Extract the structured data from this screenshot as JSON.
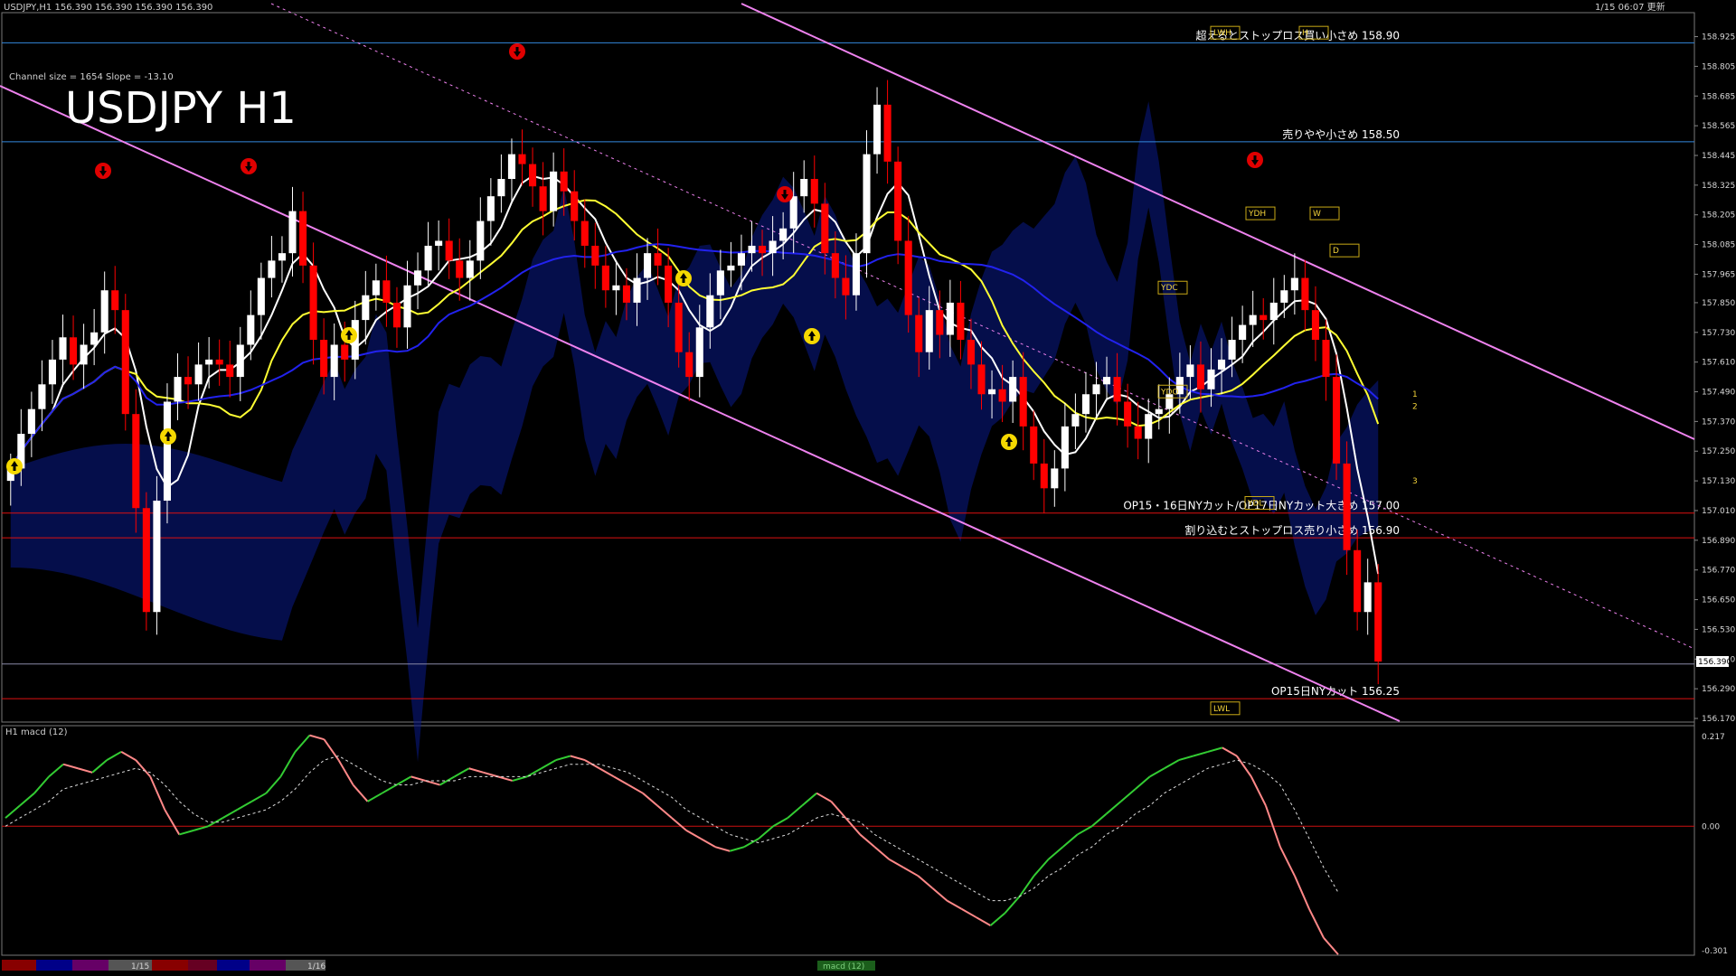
{
  "header": {
    "symbol_line": "USDJPY,H1   156.390 156.390 156.390 156.390",
    "channel_info": "Channel size = 1654 Slope = -13.10",
    "big_title": "USDJPY H1",
    "clock": "1/15 06:07 更新"
  },
  "subpanel": {
    "title": "H1  macd (12)"
  },
  "bottom_bar": {
    "dates": [
      "1/15",
      "1/16"
    ],
    "button": "macd (12)"
  },
  "colors": {
    "background": "#000000",
    "bull_candle": "#ffffff",
    "bear_candle": "#ff0000",
    "ma_fast": "#ffffff",
    "ma_mid": "#ffff33",
    "ma_slow": "#2222ee",
    "channel": "#ee82ee",
    "macd_up": "#33cc33",
    "macd_down": "#ff8888",
    "level_blue": "#3388dd",
    "level_red": "#dd1111",
    "current_price": "#8a8aa8"
  },
  "markers": {
    "up_arrow_icons": 6,
    "down_arrow_icons": 5
  },
  "chart_data": [
    {
      "type": "candlestick",
      "title": "USDJPY H1",
      "ylim": [
        156.17,
        159.0
      ],
      "y_ticks": [
        "158.925",
        "158.805",
        "158.685",
        "158.565",
        "158.445",
        "158.325",
        "158.205",
        "158.085",
        "157.965",
        "157.850",
        "157.730",
        "157.610",
        "157.490",
        "157.370",
        "157.250",
        "157.130",
        "157.010",
        "156.890",
        "156.770",
        "156.650",
        "156.530",
        "156.410",
        "156.290",
        "156.170"
      ],
      "current_price": "156.390",
      "levels": [
        {
          "price": 158.9,
          "label": "超えるとストップロス買い小さめ 158.90",
          "color": "#3388dd"
        },
        {
          "price": 158.5,
          "label": "売りやや小さめ 158.50",
          "color": "#3388dd"
        },
        {
          "price": 157.0,
          "label": "OP15・16日NYカット/OP17日NYカット大きめ 157.00",
          "color": "#dd1111"
        },
        {
          "price": 156.9,
          "label": "割り込むとストップロス売り小さめ 156.90",
          "color": "#dd1111"
        },
        {
          "price": 156.25,
          "label": "OP15日NYカット 156.25",
          "color": "#dd1111"
        }
      ],
      "tags": [
        "LWH",
        "H",
        "YDH",
        "W",
        "D",
        "YDC",
        "YDO",
        "YDL",
        "LWL",
        "1",
        "2",
        "3"
      ],
      "close": [
        157.18,
        157.32,
        157.42,
        157.52,
        157.62,
        157.71,
        157.6,
        157.68,
        157.73,
        157.9,
        157.82,
        157.4,
        157.02,
        156.6,
        157.05,
        157.45,
        157.55,
        157.52,
        157.6,
        157.62,
        157.6,
        157.55,
        157.68,
        157.8,
        157.95,
        158.02,
        158.05,
        158.22,
        158.0,
        157.7,
        157.55,
        157.68,
        157.62,
        157.78,
        157.88,
        157.94,
        157.85,
        157.75,
        157.92,
        157.98,
        158.08,
        158.1,
        158.02,
        157.95,
        158.02,
        158.18,
        158.28,
        158.35,
        158.45,
        158.41,
        158.32,
        158.22,
        158.38,
        158.3,
        158.18,
        158.08,
        158.0,
        157.9,
        157.92,
        157.85,
        157.95,
        158.05,
        158.0,
        157.85,
        157.65,
        157.55,
        157.75,
        157.88,
        157.98,
        158.0,
        158.05,
        158.08,
        158.05,
        158.1,
        158.15,
        158.28,
        158.35,
        158.25,
        158.05,
        157.95,
        157.88,
        158.05,
        158.45,
        158.65,
        158.42,
        158.1,
        157.8,
        157.65,
        157.82,
        157.72,
        157.85,
        157.7,
        157.6,
        157.48,
        157.5,
        157.45,
        157.55,
        157.35,
        157.2,
        157.1,
        157.18,
        157.35,
        157.4,
        157.48,
        157.52,
        157.55,
        157.45,
        157.35,
        157.3,
        157.4,
        157.42,
        157.48,
        157.55,
        157.6,
        157.5,
        157.58,
        157.62,
        157.7,
        157.76,
        157.8,
        157.78,
        157.85,
        157.9,
        157.95,
        157.82,
        157.7,
        157.55,
        157.2,
        156.85,
        156.6,
        156.72,
        156.4
      ]
    },
    {
      "type": "line",
      "title": "H1  macd (12)",
      "ylim": [
        -0.301,
        0.217
      ],
      "y_ticks": [
        "0.217",
        "0.00",
        "-0.301"
      ],
      "series": [
        {
          "values": [
            0.02,
            0.05,
            0.08,
            0.12,
            0.15,
            0.14,
            0.13,
            0.16,
            0.18,
            0.16,
            0.12,
            0.04,
            -0.02,
            -0.01,
            0.0,
            0.02,
            0.04,
            0.06,
            0.08,
            0.12,
            0.18,
            0.22,
            0.21,
            0.16,
            0.1,
            0.06,
            0.08,
            0.1,
            0.12,
            0.11,
            0.1,
            0.12,
            0.14,
            0.13,
            0.12,
            0.11,
            0.12,
            0.14,
            0.16,
            0.17,
            0.16,
            0.14,
            0.12,
            0.1,
            0.08,
            0.05,
            0.02,
            -0.01,
            -0.03,
            -0.05,
            -0.06,
            -0.05,
            -0.03,
            0.0,
            0.02,
            0.05,
            0.08,
            0.06,
            0.02,
            -0.02,
            -0.05,
            -0.08,
            -0.1,
            -0.12,
            -0.15,
            -0.18,
            -0.2,
            -0.22,
            -0.24,
            -0.21,
            -0.17,
            -0.12,
            -0.08,
            -0.05,
            -0.02,
            0.0,
            0.03,
            0.06,
            0.09,
            0.12,
            0.14,
            0.16,
            0.17,
            0.18,
            0.19,
            0.17,
            0.12,
            0.05,
            -0.05,
            -0.12,
            -0.2,
            -0.27,
            -0.31
          ]
        },
        {
          "values": [
            0.0,
            0.02,
            0.04,
            0.06,
            0.09,
            0.1,
            0.11,
            0.12,
            0.13,
            0.14,
            0.13,
            0.1,
            0.06,
            0.03,
            0.01,
            0.01,
            0.02,
            0.03,
            0.04,
            0.06,
            0.09,
            0.13,
            0.16,
            0.17,
            0.15,
            0.13,
            0.11,
            0.1,
            0.1,
            0.11,
            0.11,
            0.11,
            0.12,
            0.12,
            0.12,
            0.12,
            0.12,
            0.13,
            0.14,
            0.15,
            0.15,
            0.15,
            0.14,
            0.13,
            0.11,
            0.09,
            0.07,
            0.04,
            0.02,
            0.0,
            -0.02,
            -0.03,
            -0.04,
            -0.03,
            -0.02,
            0.0,
            0.02,
            0.03,
            0.02,
            0.01,
            -0.02,
            -0.04,
            -0.06,
            -0.08,
            -0.1,
            -0.12,
            -0.14,
            -0.16,
            -0.18,
            -0.18,
            -0.17,
            -0.15,
            -0.12,
            -0.1,
            -0.07,
            -0.05,
            -0.02,
            0.0,
            0.03,
            0.05,
            0.08,
            0.1,
            0.12,
            0.14,
            0.15,
            0.16,
            0.15,
            0.13,
            0.1,
            0.04,
            -0.03,
            -0.1,
            -0.16
          ]
        }
      ]
    }
  ]
}
